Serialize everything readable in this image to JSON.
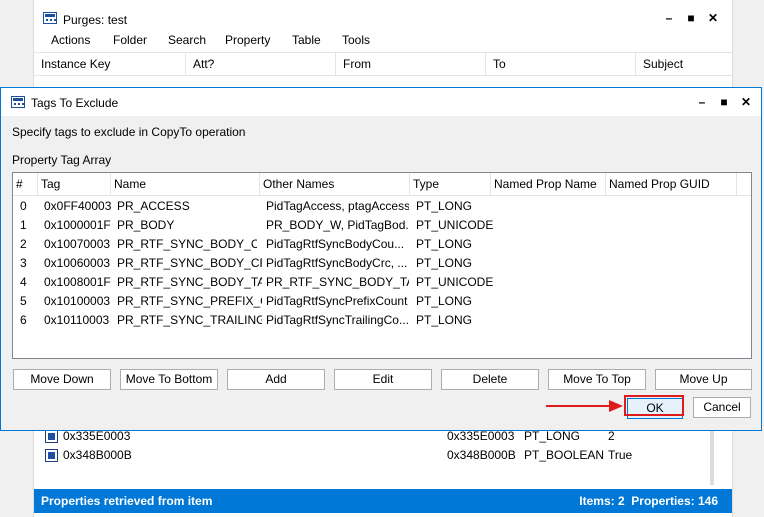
{
  "bg_window": {
    "title": "Purges: test",
    "menu": [
      "Actions",
      "Folder",
      "Search",
      "Property",
      "Table",
      "Tools"
    ],
    "columns": [
      "Instance Key",
      "Att?",
      "From",
      "To",
      "Subject"
    ],
    "rows": [
      {
        "name": "0x335E0003",
        "tag": "0x335E0003",
        "type": "PT_LONG",
        "value": "2"
      },
      {
        "name": "0x348B000B",
        "tag": "0x348B000B",
        "type": "PT_BOOLEAN",
        "value": "True"
      }
    ],
    "status_left": "Properties retrieved from item",
    "status_right": "Items: 2  Properties: 146"
  },
  "dialog": {
    "title": "Tags To Exclude",
    "instruction": "Specify tags to exclude in CopyTo operation",
    "group_label": "Property Tag Array",
    "columns": [
      "#",
      "Tag",
      "Name",
      "Other Names",
      "Type",
      "Named Prop Name",
      "Named Prop GUID"
    ],
    "rows": [
      {
        "idx": "0",
        "tag": "0x0FF40003",
        "name": "PR_ACCESS",
        "other": "PidTagAccess, ptagAccess",
        "type": "PT_LONG"
      },
      {
        "idx": "1",
        "tag": "0x1000001F",
        "name": "PR_BODY",
        "other": "PR_BODY_W, PidTagBod...",
        "type": "PT_UNICODE"
      },
      {
        "idx": "2",
        "tag": "0x10070003",
        "name": "PR_RTF_SYNC_BODY_C...",
        "other": "PidTagRtfSyncBodyCou...",
        "type": "PT_LONG"
      },
      {
        "idx": "3",
        "tag": "0x10060003",
        "name": "PR_RTF_SYNC_BODY_CRC",
        "other": "PidTagRtfSyncBodyCrc, ...",
        "type": "PT_LONG"
      },
      {
        "idx": "4",
        "tag": "0x1008001F",
        "name": "PR_RTF_SYNC_BODY_TAG",
        "other": "PR_RTF_SYNC_BODY_TA...",
        "type": "PT_UNICODE"
      },
      {
        "idx": "5",
        "tag": "0x10100003",
        "name": "PR_RTF_SYNC_PREFIX_C...",
        "other": "PidTagRtfSyncPrefixCount",
        "type": "PT_LONG"
      },
      {
        "idx": "6",
        "tag": "0x10110003",
        "name": "PR_RTF_SYNC_TRAILING...",
        "other": "PidTagRtfSyncTrailingCo...",
        "type": "PT_LONG"
      }
    ],
    "buttons": {
      "move_down": "Move Down",
      "move_to_bottom": "Move To Bottom",
      "add": "Add",
      "edit": "Edit",
      "delete": "Delete",
      "move_to_top": "Move To Top",
      "move_up": "Move Up",
      "ok": "OK",
      "cancel": "Cancel"
    }
  },
  "colors": {
    "accent": "#0078d7",
    "annotation": "#e01b1b"
  }
}
